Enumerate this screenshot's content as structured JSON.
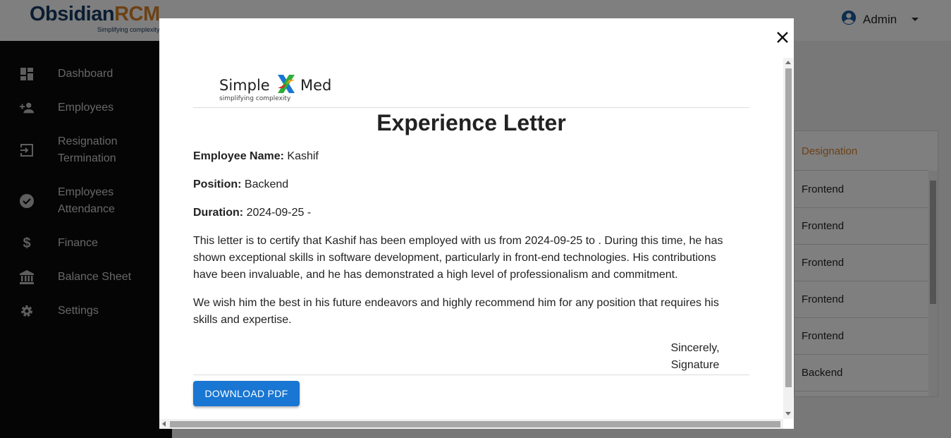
{
  "app": {
    "brand_part1": "Obsidian",
    "brand_part2": "RCM",
    "brand_tagline": "Simplifying complexity",
    "user_name": "Admin"
  },
  "sidebar": {
    "items": [
      {
        "label": "Dashboard",
        "icon": "dashboard-icon"
      },
      {
        "label": "Employees",
        "icon": "person-add-icon"
      },
      {
        "label": "Resignation Termination",
        "line1": "Resignation",
        "line2": "Termination",
        "icon": "exit-icon"
      },
      {
        "label": "Employees Attendance",
        "line1": "Employees",
        "line2": "Attendance",
        "icon": "check-circle-icon"
      },
      {
        "label": "Finance",
        "icon": "dollar-icon"
      },
      {
        "label": "Balance Sheet",
        "icon": "bank-icon"
      },
      {
        "label": "Settings",
        "icon": "gear-icon"
      }
    ]
  },
  "table": {
    "column_header": "Designation",
    "rows": [
      "Frontend",
      "Frontend",
      "Frontend",
      "Frontend",
      "Frontend",
      "Backend"
    ]
  },
  "modal": {
    "logo_simple": "Simple",
    "logo_med": "Med",
    "logo_tagline": "simplifying complexity",
    "title": "Experience Letter",
    "employee_name_label": "Employee Name:",
    "employee_name": "Kashif",
    "position_label": "Position:",
    "position": "Backend",
    "duration_label": "Duration:",
    "duration": "2024-09-25 -",
    "para1_line1": "This letter is to certify that Kashif has been employed with us from 2024-09-25 to . During this time, he has",
    "para1_line2": "shown exceptional skills in software development, particularly in front-end technologies. His contributions",
    "para1_line3": "have been invaluable, and he has demonstrated a high level of professionalism and commitment.",
    "para2_line1": "We wish him the best in his future endeavors and highly recommend him for any position that requires his",
    "para2_line2": "skills and expertise.",
    "sincerely": "Sincerely,",
    "signature": "Signature",
    "download_button": "DOWNLOAD PDF"
  },
  "colors": {
    "accent": "#1976d2",
    "brand_navy": "#173a63",
    "brand_orange": "#d9822b",
    "sidebar_bg": "#0b0b0b"
  }
}
